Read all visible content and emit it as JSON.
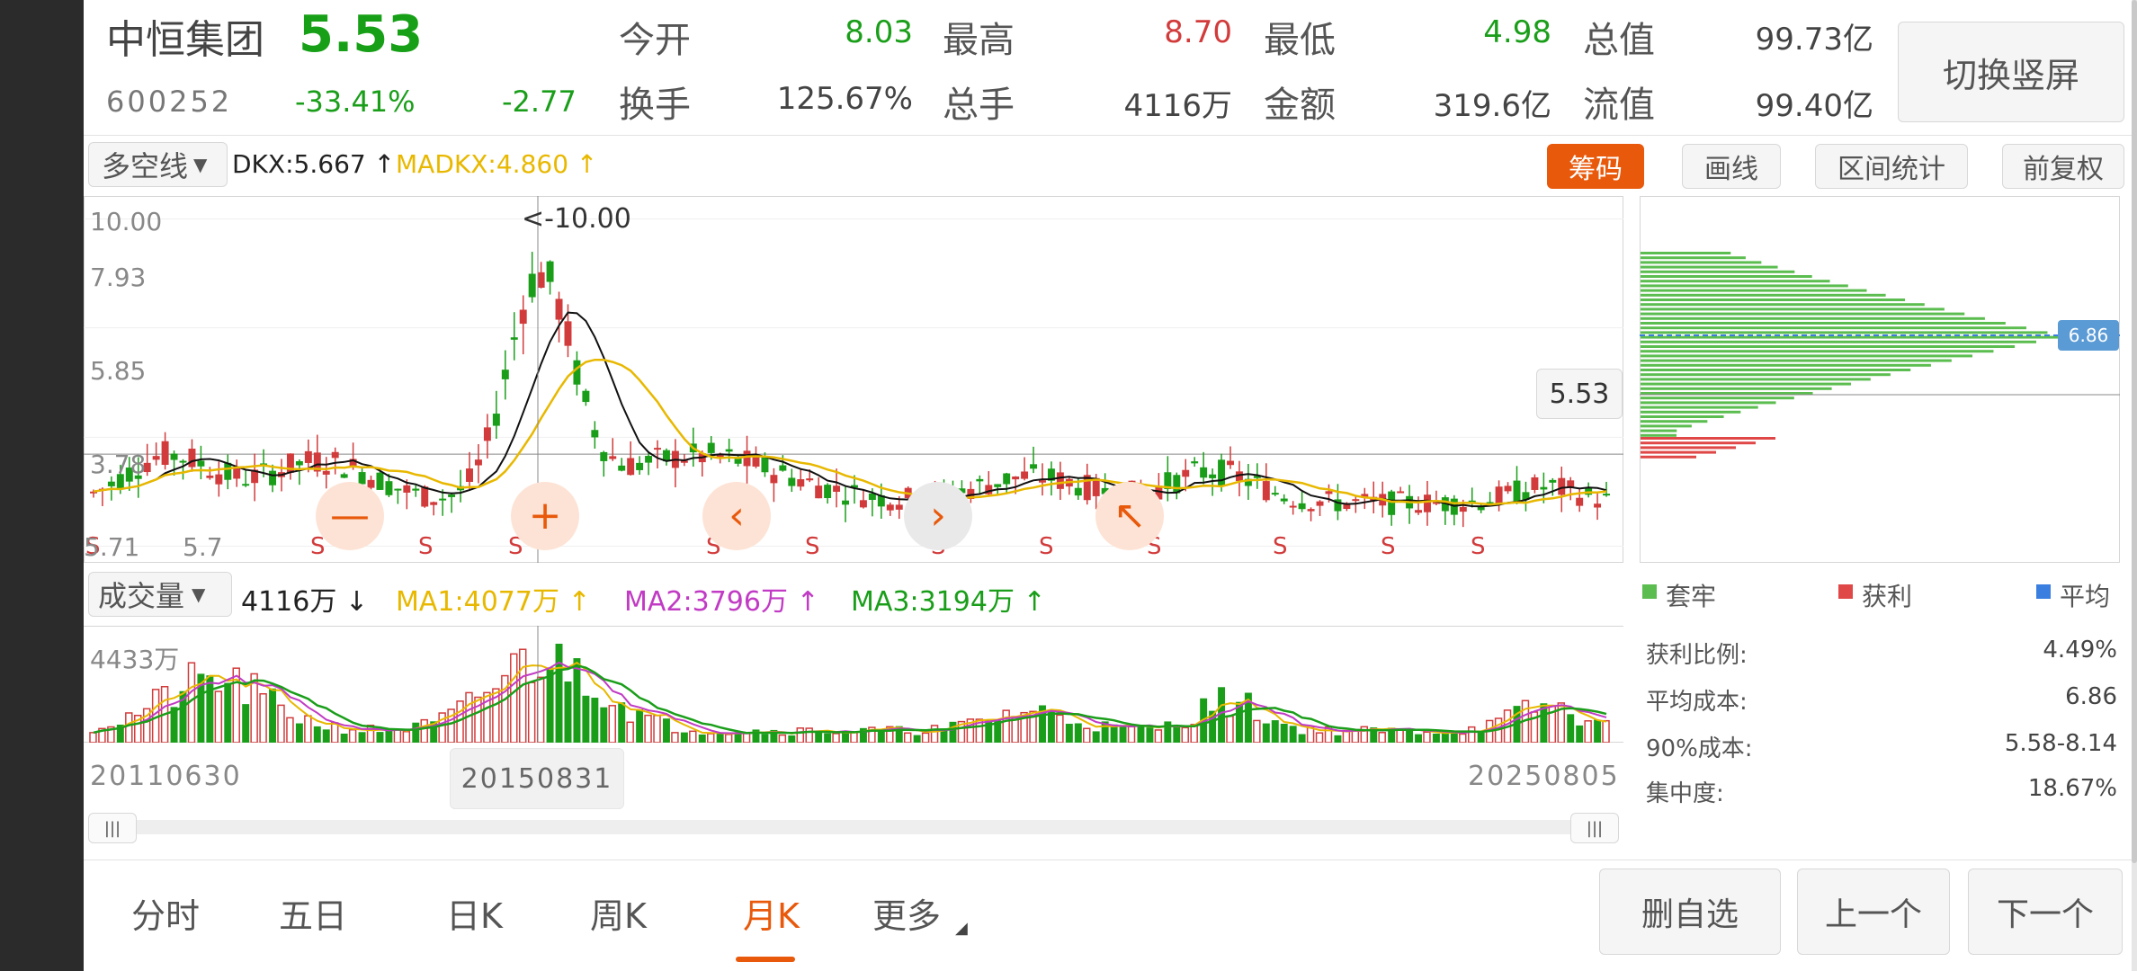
{
  "header": {
    "name": "中恒集团",
    "price": "5.53",
    "code": "600252",
    "change_pct": "-33.41%",
    "change": "-2.77",
    "fields": [
      {
        "label": "今开",
        "value": "8.03",
        "color": "#1a9e1a"
      },
      {
        "label": "最高",
        "value": "8.70",
        "color": "#d23b3b"
      },
      {
        "label": "最低",
        "value": "4.98",
        "color": "#1a9e1a"
      },
      {
        "label": "总值",
        "value": "99.73亿",
        "color": "#444444"
      },
      {
        "label": "换手",
        "value": "125.67%",
        "color": "#444444"
      },
      {
        "label": "总手",
        "value": "4116万",
        "color": "#444444"
      },
      {
        "label": "金额",
        "value": "319.6亿",
        "color": "#444444"
      },
      {
        "label": "流值",
        "value": "99.40亿",
        "color": "#444444"
      }
    ],
    "switch_button": "切换竖屏"
  },
  "toolbar": {
    "indicator_select": "多空线",
    "dkx": "DKX:5.667 ↑",
    "madkx": "MADKX:4.860 ↑",
    "chip_button": "筹码",
    "draw_button": "画线",
    "range_button": "区间统计",
    "fq_button": "前复权"
  },
  "price_chart": {
    "y_labels": [
      "10.00",
      "7.93",
      "5.85",
      "3.78",
      "5.71"
    ],
    "max_marker": "<-10.00",
    "current_price": "5.53",
    "s_marker": "S",
    "marker_5_7": "5.7"
  },
  "volume": {
    "select": "成交量",
    "value": "4116万 ↓",
    "ma1": "MA1:4077万 ↑",
    "ma2": "MA2:3796万 ↑",
    "ma3": "MA3:3194万 ↑",
    "y_label": "4433万",
    "date_start": "20110630",
    "date_cursor": "20150831",
    "date_end": "20250805"
  },
  "chips": {
    "avg_tag": "6.86",
    "legend": [
      {
        "label": "套牢",
        "color": "#5bbd4f"
      },
      {
        "label": "获利",
        "color": "#e04848"
      },
      {
        "label": "平均",
        "color": "#3a7ee0"
      }
    ],
    "stats": [
      {
        "label": "获利比例:",
        "value": "4.49%"
      },
      {
        "label": "平均成本:",
        "value": "6.86"
      },
      {
        "label": "90%成本:",
        "value": "5.58-8.14"
      },
      {
        "label": "集中度:",
        "value": "18.67%"
      }
    ]
  },
  "scroll": {
    "handle_left": "|||",
    "handle_right": "|||"
  },
  "tabs": [
    "分时",
    "五日",
    "日K",
    "周K",
    "月K",
    "更多"
  ],
  "active_tab": "月K",
  "bottom_buttons": [
    "删自选",
    "上一个",
    "下一个"
  ],
  "colors": {
    "up": "#d23b3b",
    "down": "#1a9e1a",
    "accent": "#e8590c",
    "ma1": "#e8b800",
    "ma2": "#c13bc4",
    "ma3": "#1a9e1a",
    "dkx": "#111111",
    "madkx": "#e8b800"
  }
}
